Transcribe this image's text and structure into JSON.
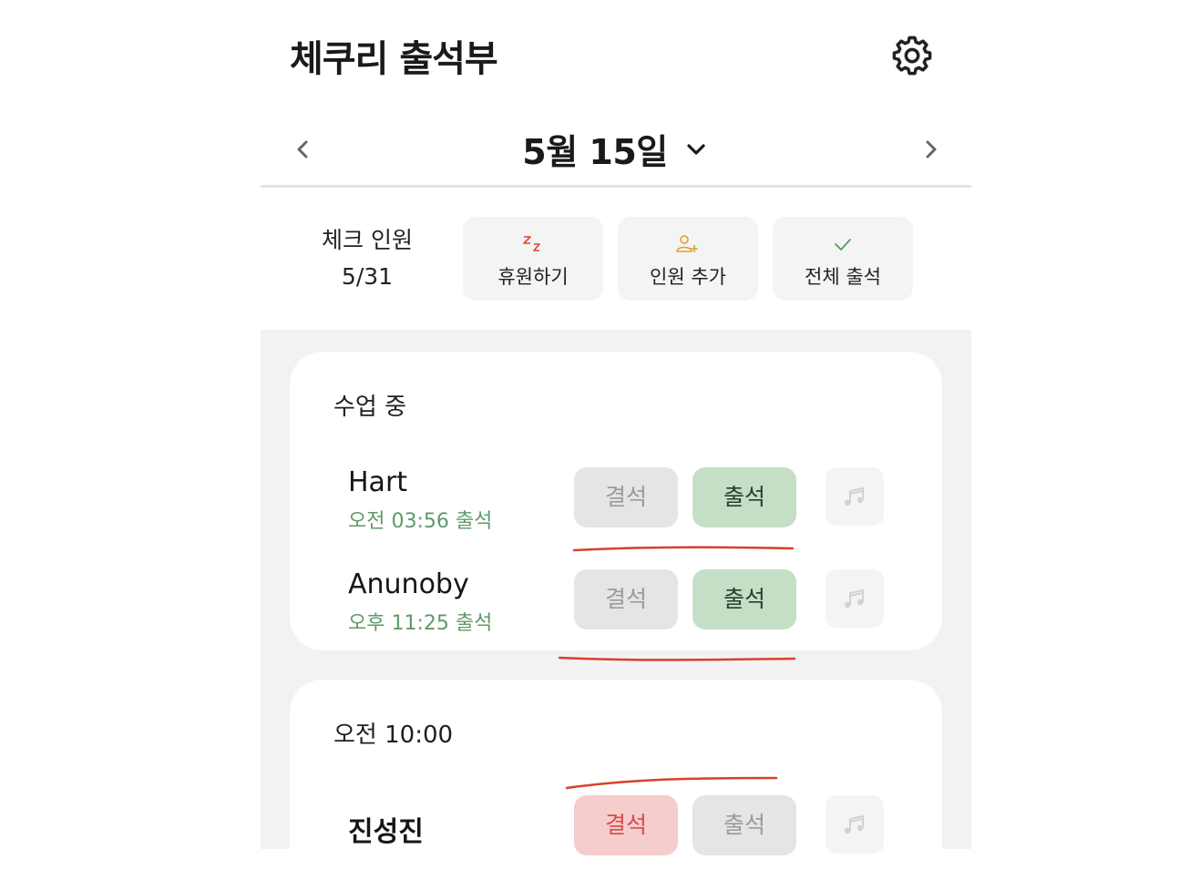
{
  "header": {
    "title": "체쿠리 출석부",
    "settings_icon": "gear-icon"
  },
  "date_nav": {
    "date": "5월 15일",
    "prev_icon": "chevron-left-icon",
    "next_icon": "chevron-right-icon",
    "dropdown_icon": "chevron-down-icon"
  },
  "summary": {
    "label": "체크 인원",
    "count": "5/31"
  },
  "actions": [
    {
      "label": "휴원하기",
      "icon": "zzz-icon",
      "color": "#d9462c"
    },
    {
      "label": "인원 추가",
      "icon": "add-user-icon",
      "color": "#e0a02a"
    },
    {
      "label": "전체 출석",
      "icon": "check-icon",
      "color": "#4e9a5a"
    }
  ],
  "sections": [
    {
      "title": "수업 중",
      "rows": [
        {
          "name": "Hart",
          "time": "오전 03:56 출석",
          "absent_label": "결석",
          "present_label": "출석",
          "status": "present"
        },
        {
          "name": "Anunoby",
          "time": "오후 11:25 출석",
          "absent_label": "결석",
          "present_label": "출석",
          "status": "present"
        }
      ]
    },
    {
      "title": "오전 10:00",
      "rows": [
        {
          "name": "진성진",
          "time": "",
          "absent_label": "결석",
          "present_label": "출석",
          "status": "absent"
        }
      ]
    }
  ],
  "colors": {
    "present_bg": "#c5dfc6",
    "absent_bg": "#f5cdcd",
    "time_text": "#5f9a6a",
    "annotation": "#d9402a"
  }
}
